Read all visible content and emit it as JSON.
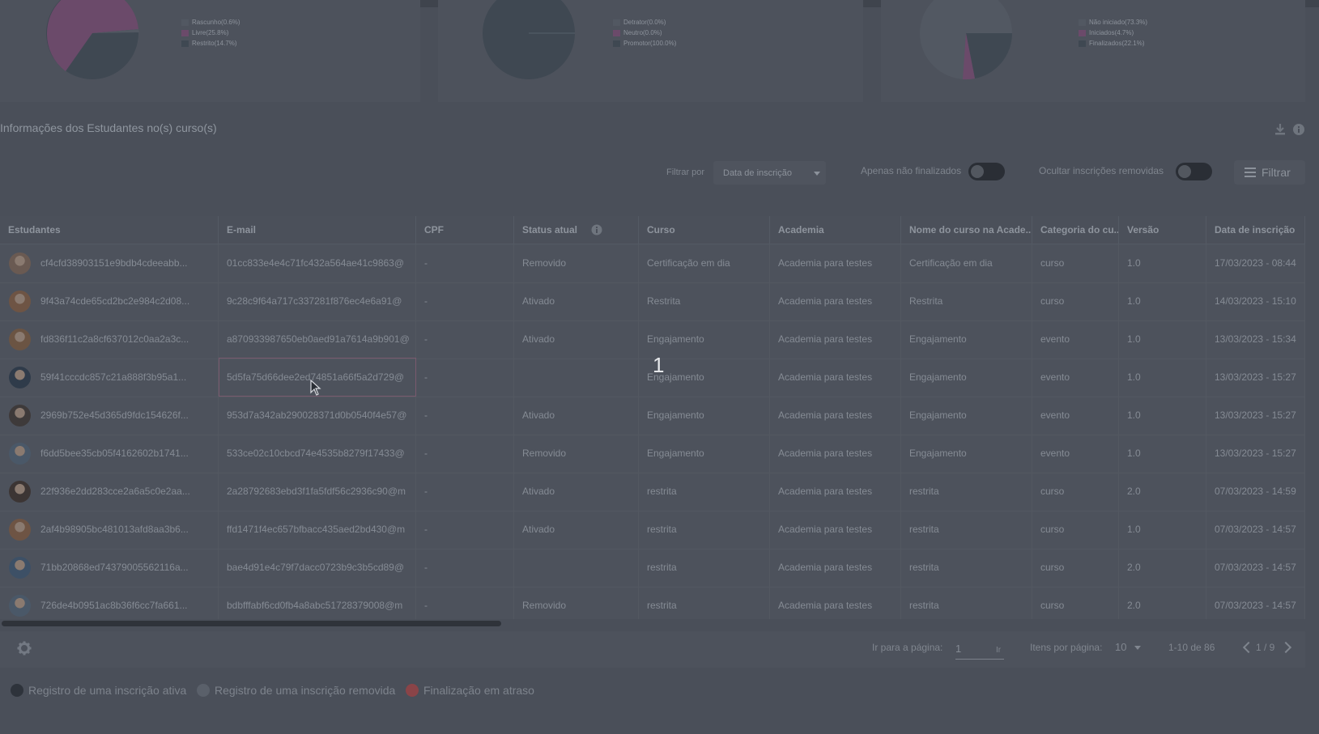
{
  "charts": [
    {
      "legend": [
        {
          "label": "Rascunho(0.6%)",
          "color": "#525862"
        },
        {
          "label": "Livre(25.8%)",
          "color": "#6b4a6a"
        },
        {
          "label": "Restrito(14.7%)",
          "color": "#3f4852"
        }
      ]
    },
    {
      "legend": [
        {
          "label": "Detrator(0.0%)",
          "color": "#525862"
        },
        {
          "label": "Neutro(0.0%)",
          "color": "#6b4a6a"
        },
        {
          "label": "Promotor(100.0%)",
          "color": "#3f4852"
        }
      ]
    },
    {
      "legend": [
        {
          "label": "Não iniciado(73.3%)",
          "color": "#525862"
        },
        {
          "label": "Iniciados(4.7%)",
          "color": "#6b4a6a"
        },
        {
          "label": "Finalizados(22.1%)",
          "color": "#3f4852"
        }
      ]
    }
  ],
  "section": {
    "title": "Informações dos Estudantes no(s) curso(s)"
  },
  "toolbar": {
    "filter_by_label": "Filtrar por",
    "filter_by_value": "Data de inscrição",
    "only_unfinished_label": "Apenas não finalizados",
    "hide_removed_label": "Ocultar inscrições removidas",
    "filter_button": "Filtrar"
  },
  "table": {
    "columns": [
      "Estudantes",
      "E-mail",
      "CPF",
      "Status atual",
      "Curso",
      "Academia",
      "Nome do curso na Acade...",
      "Categoria do cu...",
      "Versão",
      "Data de inscrição"
    ],
    "rows": [
      {
        "student": "cf4cfd38903151e9bdb4cdeeabb...",
        "email": "01cc833e4e4c71fc432a564ae41c9863@",
        "cpf": "-",
        "status": "Removido",
        "course": "Certificação em dia",
        "academy": "Academia para testes",
        "course_name": "Certificação em dia",
        "category": "curso",
        "version": "1.0",
        "date": "17/03/2023 - 08:44"
      },
      {
        "student": "9f43a74cde65cd2bc2e984c2d08...",
        "email": "9c28c9f64a717c337281f876ec4e6a91@",
        "cpf": "-",
        "status": "Ativado",
        "course": "Restrita",
        "academy": "Academia para testes",
        "course_name": "Restrita",
        "category": "curso",
        "version": "1.0",
        "date": "14/03/2023 - 15:10"
      },
      {
        "student": "fd836f11c2a8cf637012c0aa2a3c...",
        "email": "a870933987650eb0aed91a7614a9b901@",
        "cpf": "-",
        "status": "Ativado",
        "course": "Engajamento",
        "academy": "Academia para testes",
        "course_name": "Engajamento",
        "category": "evento",
        "version": "1.0",
        "date": "13/03/2023 - 15:34"
      },
      {
        "student": "59f41cccdc857c21a888f3b95a1...",
        "email": "5d5fa75d66dee2ed74851a66f5a2d729@",
        "cpf": "-",
        "status": "",
        "course": "Engajamento",
        "academy": "Academia para testes",
        "course_name": "Engajamento",
        "category": "evento",
        "version": "1.0",
        "date": "13/03/2023 - 15:27"
      },
      {
        "student": "2969b752e45d365d9fdc154626f...",
        "email": "953d7a342ab290028371d0b0540f4e57@",
        "cpf": "-",
        "status": "Ativado",
        "course": "Engajamento",
        "academy": "Academia para testes",
        "course_name": "Engajamento",
        "category": "evento",
        "version": "1.0",
        "date": "13/03/2023 - 15:27"
      },
      {
        "student": "f6dd5bee35cb05f4162602b1741...",
        "email": "533ce02c10cbcd74e4535b8279f17433@",
        "cpf": "-",
        "status": "Removido",
        "course": "Engajamento",
        "academy": "Academia para testes",
        "course_name": "Engajamento",
        "category": "evento",
        "version": "1.0",
        "date": "13/03/2023 - 15:27"
      },
      {
        "student": "22f936e2dd283cce2a6a5c0e2aa...",
        "email": "2a28792683ebd3f1fa5fdf56c2936c90@m",
        "cpf": "-",
        "status": "Ativado",
        "course": "restrita",
        "academy": "Academia para testes",
        "course_name": "restrita",
        "category": "curso",
        "version": "2.0",
        "date": "07/03/2023 - 14:59"
      },
      {
        "student": "2af4b98905bc481013afd8aa3b6...",
        "email": "ffd1471f4ec657bfbacc435aed2bd430@m",
        "cpf": "-",
        "status": "Ativado",
        "course": "restrita",
        "academy": "Academia para testes",
        "course_name": "restrita",
        "category": "curso",
        "version": "1.0",
        "date": "07/03/2023 - 14:57"
      },
      {
        "student": "71bb20868ed74379005562116a...",
        "email": "bae4d91e4c79f7dacc0723b9c3b5cd89@",
        "cpf": "-",
        "status": "",
        "course": "restrita",
        "academy": "Academia para testes",
        "course_name": "restrita",
        "category": "curso",
        "version": "2.0",
        "date": "07/03/2023 - 14:57"
      },
      {
        "student": "726de4b0951ac8b36f6cc7fa661...",
        "email": "bdbfffabf6cd0fb4a8abc51728379008@m",
        "cpf": "-",
        "status": "Removido",
        "course": "restrita",
        "academy": "Academia para testes",
        "course_name": "restrita",
        "category": "curso",
        "version": "2.0",
        "date": "07/03/2023 - 14:57"
      }
    ]
  },
  "pagination": {
    "go_to_page_label": "Ir para a página:",
    "page_value": "1",
    "go_label": "Ir",
    "items_per_page_label": "Itens por página:",
    "items_per_page_value": "10",
    "range": "1-10 de 86",
    "page_indicator": "1 / 9"
  },
  "legend_keys": [
    {
      "label": "Registro de uma inscrição ativa",
      "color": "#2e333b"
    },
    {
      "label": "Registro de uma inscrição removida",
      "color": "#5a606a"
    },
    {
      "label": "Finalização em atraso",
      "color": "#8a4448"
    }
  ],
  "overlay_marker": "1",
  "icons": [
    "download-icon",
    "info-icon",
    "filter-lines-icon",
    "gear-icon",
    "chevron-left-icon",
    "chevron-right-icon",
    "caret-down-icon",
    "pointer-cursor-icon"
  ]
}
